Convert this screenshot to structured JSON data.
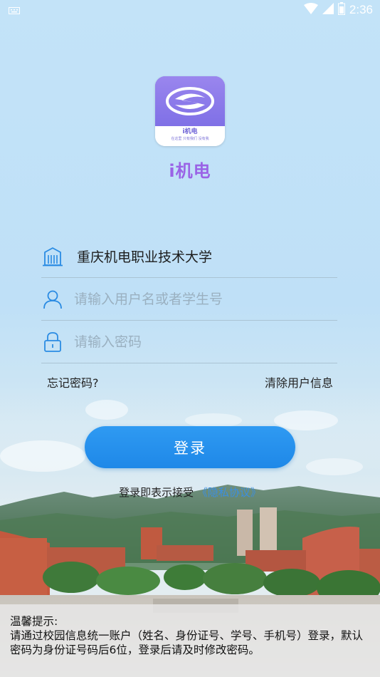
{
  "status_bar": {
    "time": "2:36",
    "icons": [
      "keyboard-icon",
      "wifi-icon",
      "signal-icon",
      "battery-icon"
    ]
  },
  "app": {
    "name": "i机电",
    "logo_text": "i机电",
    "logo_slogan": "在这里 只有我们 没有我"
  },
  "form": {
    "school": "重庆机电职业技术大学",
    "username_placeholder": "请输入用户名或者学生号",
    "password_placeholder": "请输入密码"
  },
  "links": {
    "forgot_password": "忘记密码?",
    "clear_user_info": "清除用户信息"
  },
  "login_button": "登录",
  "agreement": {
    "prefix": "登录即表示接受",
    "privacy_link": "《隐私协议》"
  },
  "notice": {
    "title": "温馨提示:",
    "body": "请通过校园信息统一账户（姓名、身份证号、学号、手机号）登录，默认密码为身份证号码后6位，登录后请及时修改密码。"
  },
  "colors": {
    "accent": "#1e88e8",
    "brand_purple": "#9a63e6",
    "icon_blue": "#2a8be3",
    "link_blue": "#3c8fe0"
  }
}
